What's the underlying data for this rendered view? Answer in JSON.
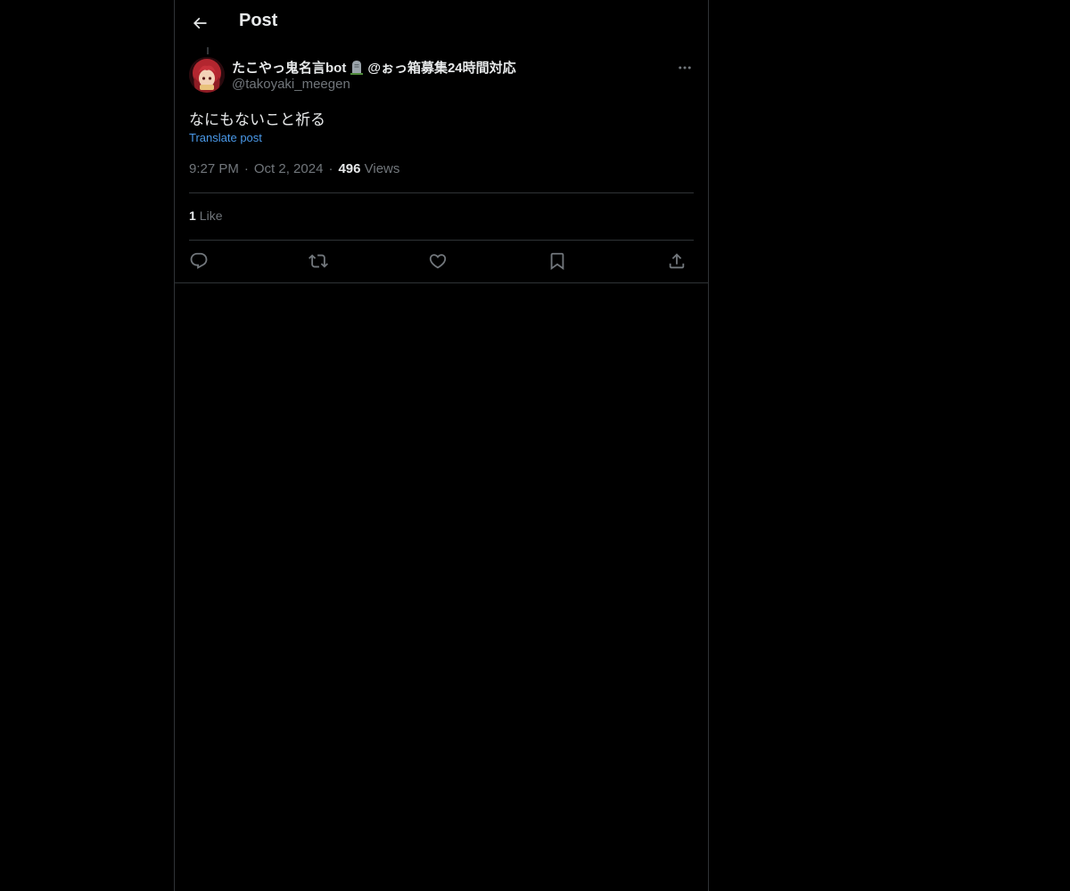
{
  "header": {
    "title": "Post"
  },
  "post": {
    "author": {
      "display_name_prefix": "たこやっ鬼名言bot",
      "display_name_suffix": "@ぉっ箱募集24時間対応",
      "handle": "@takoyaki_meegen"
    },
    "text": "なにもないこと祈る",
    "translate_label": "Translate post",
    "time": "9:27 PM",
    "date": "Oct 2, 2024",
    "views_count": "496",
    "views_label": "Views",
    "likes_count": "1",
    "likes_label": "Like",
    "meta_separator": "·"
  },
  "icons": {
    "back": "arrow-left-icon",
    "more": "more-horizontal-icon",
    "reply": "reply-icon",
    "repost": "repost-icon",
    "like": "heart-icon",
    "bookmark": "bookmark-icon",
    "share": "share-icon"
  },
  "colors": {
    "background": "#000000",
    "text": "#e7e9ea",
    "muted": "#71767b",
    "link": "#4a99e9",
    "border": "#2f3336"
  }
}
